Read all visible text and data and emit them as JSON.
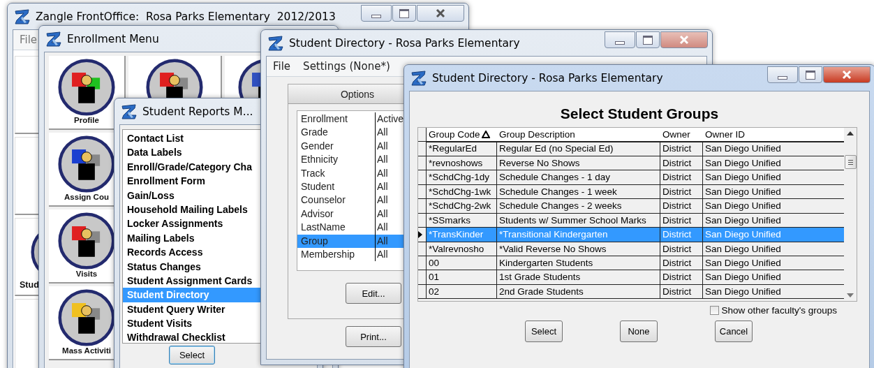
{
  "main_window": {
    "title": "Zangle FrontOffice:  Rosa Parks Elementary  2012/2013",
    "active": false,
    "menu": [
      "File"
    ],
    "tiles": [
      {
        "label": "Stud"
      }
    ]
  },
  "enrollment_menu": {
    "title": "Enrollment Menu",
    "active": false,
    "tiles": [
      {
        "label": "Profile"
      },
      {
        "label": "Assign Cou"
      },
      {
        "label": "Visits"
      },
      {
        "label": "Mass Activiti"
      }
    ]
  },
  "student_reports_menu": {
    "title": "Student Reports M...",
    "active": false,
    "items": [
      {
        "label": "Contact List",
        "selected": false
      },
      {
        "label": "Data Labels",
        "selected": false
      },
      {
        "label": "Enroll/Grade/Category Cha",
        "selected": false
      },
      {
        "label": "Enrollment Form",
        "selected": false
      },
      {
        "label": "Gain/Loss",
        "selected": false
      },
      {
        "label": "Household Mailing Labels",
        "selected": false
      },
      {
        "label": "Locker Assignments",
        "selected": false
      },
      {
        "label": "Mailing Labels",
        "selected": false
      },
      {
        "label": "Records Access",
        "selected": false
      },
      {
        "label": "Status Changes",
        "selected": false
      },
      {
        "label": "Student Assignment Cards",
        "selected": false
      },
      {
        "label": "Student Directory",
        "selected": true
      },
      {
        "label": "Student Query Writer",
        "selected": false
      },
      {
        "label": "Student Visits",
        "selected": false
      },
      {
        "label": "Withdrawal Checklist",
        "selected": false
      }
    ],
    "button": "Select"
  },
  "student_directory": {
    "title": "Student Directory - Rosa Parks Elementary",
    "active": false,
    "menu": [
      "File",
      "Settings (None*)"
    ],
    "options_header": "Options",
    "options": [
      {
        "name": "Enrollment",
        "value": "Active",
        "selected": false
      },
      {
        "name": "Grade",
        "value": "All",
        "selected": false
      },
      {
        "name": "Gender",
        "value": "All",
        "selected": false
      },
      {
        "name": "Ethnicity",
        "value": "All",
        "selected": false
      },
      {
        "name": "Track",
        "value": "All",
        "selected": false
      },
      {
        "name": "Student",
        "value": "All",
        "selected": false
      },
      {
        "name": "Counselor",
        "value": "All",
        "selected": false
      },
      {
        "name": "Advisor",
        "value": "All",
        "selected": false
      },
      {
        "name": "LastName",
        "value": "All",
        "selected": false
      },
      {
        "name": "Group",
        "value": "All",
        "selected": true
      },
      {
        "name": "Membership",
        "value": "All",
        "selected": false
      }
    ],
    "edit_button": "Edit...",
    "print_button": "Print..."
  },
  "select_groups_dialog": {
    "title": "Student Directory - Rosa Parks Elementary",
    "active": true,
    "heading": "Select Student Groups",
    "columns": [
      "Group Code",
      "Group Description",
      "Owner",
      "Owner ID"
    ],
    "rows": [
      {
        "code": "*RegularEd",
        "description": "Regular Ed (no Special Ed)",
        "owner": "District",
        "owner_id": "San Diego Unified",
        "selected": false
      },
      {
        "code": "*revnoshows",
        "description": "Reverse No Shows",
        "owner": "District",
        "owner_id": "San Diego Unified",
        "selected": false
      },
      {
        "code": "*SchdChg-1dy",
        "description": "Schedule Changes - 1 day",
        "owner": "District",
        "owner_id": "San Diego Unified",
        "selected": false
      },
      {
        "code": "*SchdChg-1wk",
        "description": "Schedule Changes - 1 week",
        "owner": "District",
        "owner_id": "San Diego Unified",
        "selected": false
      },
      {
        "code": "*SchdChg-2wk",
        "description": "Schedule Changes - 2 weeks",
        "owner": "District",
        "owner_id": "San Diego Unified",
        "selected": false
      },
      {
        "code": "*SSmarks",
        "description": "Students w/ Summer School Marks",
        "owner": "District",
        "owner_id": "San Diego Unified",
        "selected": false
      },
      {
        "code": "*TransKinder",
        "description": "*Transitional Kindergarten",
        "owner": "District",
        "owner_id": "San Diego Unified",
        "selected": true
      },
      {
        "code": "*Valrevnosho",
        "description": "*Valid Reverse No Shows",
        "owner": "District",
        "owner_id": "San Diego Unified",
        "selected": false
      },
      {
        "code": "00",
        "description": "Kindergarten Students",
        "owner": "District",
        "owner_id": "San Diego Unified",
        "selected": false
      },
      {
        "code": "01",
        "description": "1st Grade Students",
        "owner": "District",
        "owner_id": "San Diego Unified",
        "selected": false
      },
      {
        "code": "02",
        "description": "2nd Grade Students",
        "owner": "District",
        "owner_id": "San Diego Unified",
        "selected": false
      }
    ],
    "checkbox": {
      "label": "Show other faculty's groups",
      "checked": false
    },
    "buttons": [
      "Select",
      "None",
      "Cancel"
    ]
  }
}
